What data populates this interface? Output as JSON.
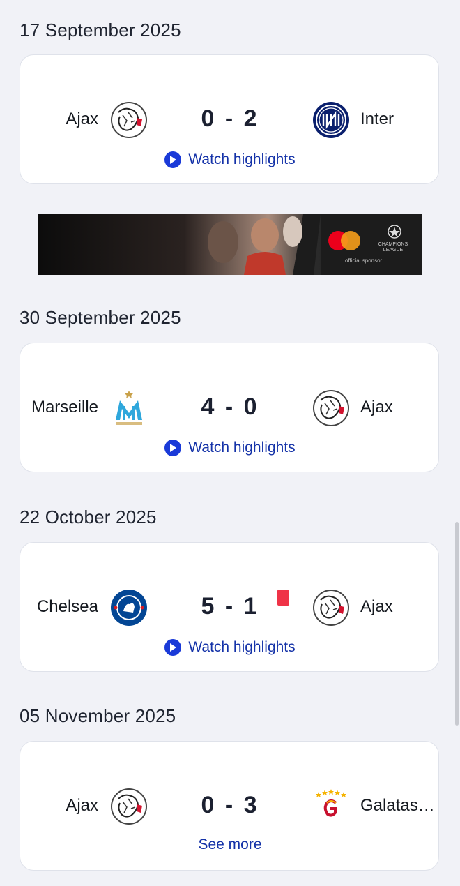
{
  "matches": [
    {
      "date": "17 September 2025",
      "home": "Ajax",
      "away": "Inter",
      "score": "0 - 2",
      "cta": "Watch highlights"
    },
    {
      "date": "30 September 2025",
      "home": "Marseille",
      "away": "Ajax",
      "score": "4 - 0",
      "cta": "Watch highlights"
    },
    {
      "date": "22 October 2025",
      "home": "Chelsea",
      "away": "Ajax",
      "score": "5 - 1",
      "cta": "Watch highlights"
    },
    {
      "date": "05 November 2025",
      "home": "Ajax",
      "away": "Galatas…",
      "score": "0 - 3",
      "cta": "See more"
    }
  ],
  "banner": {
    "league_text": "CHAMPIONS LEAGUE",
    "tagline": "official sponsor"
  },
  "icons": {
    "play": "play-icon",
    "ajax": "ajax-crest-icon",
    "inter": "inter-crest-icon",
    "marseille": "marseille-crest-icon",
    "chelsea": "chelsea-crest-icon",
    "galatasaray": "galatasaray-crest-icon"
  },
  "colors": {
    "accent": "#1a3ad8",
    "link": "#1432a8",
    "red_card": "#ef3347",
    "background": "#f1f2f7"
  }
}
